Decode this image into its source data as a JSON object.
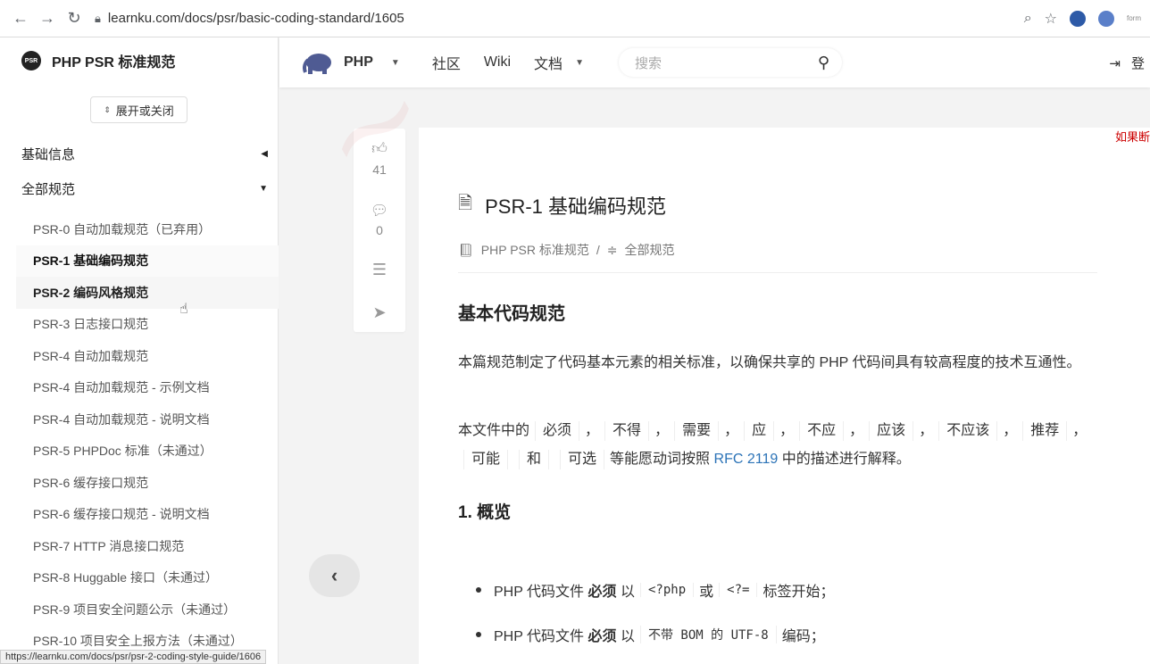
{
  "browser": {
    "url": "learnku.com/docs/psr/basic-coding-standard/1605",
    "status_url": "https://learnku.com/docs/psr/psr-2-coding-style-guide/1606"
  },
  "sidebar": {
    "logo_text": "PSR",
    "title": "PHP PSR 标准规范",
    "toggle_label": "展开或关闭",
    "groups": [
      {
        "label": "基础信息"
      },
      {
        "label": "全部规范"
      }
    ],
    "items": [
      {
        "label": "PSR-0 自动加载规范（已弃用）"
      },
      {
        "label": "PSR-1 基础编码规范"
      },
      {
        "label": "PSR-2 编码风格规范"
      },
      {
        "label": "PSR-3 日志接口规范"
      },
      {
        "label": "PSR-4 自动加载规范"
      },
      {
        "label": "PSR-4 自动加载规范 - 示例文档"
      },
      {
        "label": "PSR-4 自动加载规范 - 说明文档"
      },
      {
        "label": "PSR-5 PHPDoc 标准（未通过）"
      },
      {
        "label": "PSR-6 缓存接口规范"
      },
      {
        "label": "PSR-6 缓存接口规范 - 说明文档"
      },
      {
        "label": "PSR-7 HTTP 消息接口规范"
      },
      {
        "label": "PSR-8 Huggable 接口（未通过）"
      },
      {
        "label": "PSR-9 项目安全问题公示（未通过）"
      },
      {
        "label": "PSR-10 项目安全上报方法（未通过）"
      }
    ]
  },
  "topnav": {
    "brand": "PHP",
    "links": [
      "社区",
      "Wiki",
      "文档"
    ],
    "search_placeholder": "搜索",
    "login": "登"
  },
  "actions": {
    "likes": "41",
    "comments": "0"
  },
  "article": {
    "title": "PSR-1 基础编码规范",
    "breadcrumb": [
      "PHP PSR 标准规范",
      "/",
      "全部规范"
    ],
    "h2": "基本代码规范",
    "intro": "本篇规范制定了代码基本元素的相关标准，以确保共享的 PHP 代码间具有较高程度的技术互通性。",
    "kw_prefix": "本文件中的",
    "keywords": [
      "必须",
      "不得",
      "需要",
      "应",
      "不应",
      "应该",
      "不应该",
      "推荐",
      "可能",
      "和",
      "可选"
    ],
    "kw_suffix_a": "等能愿动词按照",
    "rfc_link": "RFC 2119",
    "kw_suffix_b": "中的描述进行解释。",
    "section1": "1. 概览",
    "b1_a": "PHP 代码文件",
    "b1_must": "必须",
    "b1_b": "以",
    "b1_code1": "<?php",
    "b1_or": "或",
    "b1_code2": "<?=",
    "b1_c": "标签开始；",
    "b2_a": "PHP 代码文件",
    "b2_must": "必须",
    "b2_b": "以",
    "b2_code": "不带 BOM 的 UTF-8",
    "b2_c": "编码；"
  },
  "overlay": {
    "red_text": "如果断"
  }
}
